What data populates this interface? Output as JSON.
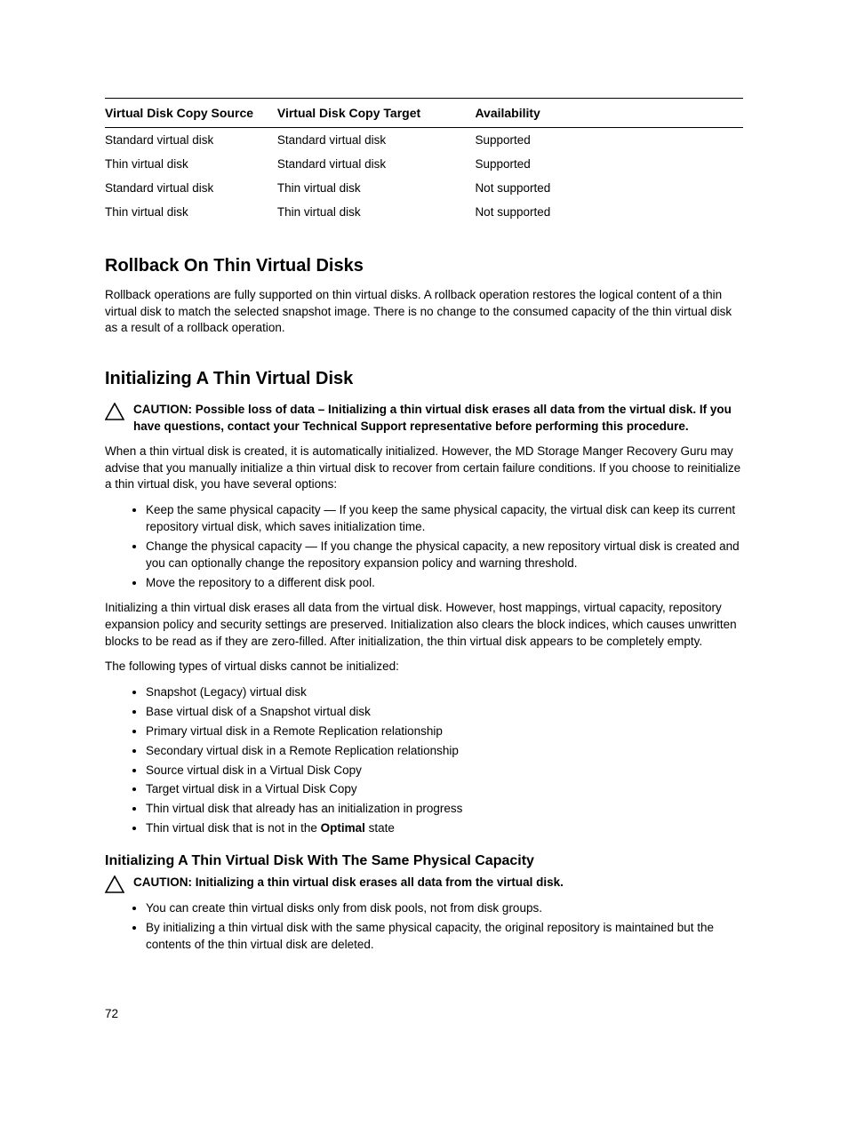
{
  "table": {
    "headers": [
      "Virtual Disk Copy Source",
      "Virtual Disk Copy Target",
      "Availability"
    ],
    "rows": [
      [
        "Standard virtual disk",
        "Standard virtual disk",
        "Supported"
      ],
      [
        "Thin virtual disk",
        "Standard virtual disk",
        "Supported"
      ],
      [
        "Standard virtual disk",
        "Thin virtual disk",
        "Not supported"
      ],
      [
        "Thin virtual disk",
        "Thin virtual disk",
        "Not supported"
      ]
    ]
  },
  "section1": {
    "title": "Rollback On Thin Virtual Disks",
    "p1": "Rollback operations are fully supported on thin virtual disks. A rollback operation restores the logical content of a thin virtual disk to match the selected snapshot image. There is no change to the consumed capacity of the thin virtual disk as a result of a rollback operation."
  },
  "section2": {
    "title": "Initializing A Thin Virtual Disk",
    "caution1": "CAUTION: Possible loss of data – Initializing a thin virtual disk erases all data from the virtual disk. If you have questions, contact your Technical Support representative before performing this procedure.",
    "p1": "When a thin virtual disk is created, it is automatically initialized. However, the MD Storage Manger Recovery Guru may advise that you manually initialize a thin virtual disk to recover from certain failure conditions. If you choose to reinitialize a thin virtual disk, you have several options:",
    "options": [
      "Keep the same physical capacity — If you keep the same physical capacity, the virtual disk can keep its current repository virtual disk, which saves initialization time.",
      "Change the physical capacity — If you change the physical capacity, a new repository virtual disk is created and you can optionally change the repository expansion policy and warning threshold.",
      "Move the repository to a different disk pool."
    ],
    "p2": "Initializing a thin virtual disk erases all data from the virtual disk. However, host mappings, virtual capacity, repository expansion policy and security settings are preserved. Initialization also clears the block indices, which causes unwritten blocks to be read as if they are zero-filled. After initialization, the thin virtual disk appears to be completely empty.",
    "p3": "The following types of virtual disks cannot be initialized:",
    "cannot_list": [
      "Snapshot (Legacy) virtual disk",
      "Base virtual disk of a Snapshot virtual disk",
      "Primary virtual disk in a Remote Replication relationship",
      "Secondary virtual disk in a Remote Replication relationship",
      "Source virtual disk in a Virtual Disk Copy",
      "Target virtual disk in a Virtual Disk Copy",
      "Thin virtual disk that already has an initialization in progress"
    ],
    "cannot_last_pre": "Thin virtual disk that is not in the ",
    "cannot_last_bold": "Optimal",
    "cannot_last_post": " state",
    "sub1_title": "Initializing A Thin Virtual Disk With The Same Physical Capacity",
    "caution2": "CAUTION: Initializing a thin virtual disk erases all data from the virtual disk.",
    "sub1_list": [
      "You can create thin virtual disks only from disk pools, not from disk groups.",
      "By initializing a thin virtual disk with the same physical capacity, the original repository is maintained but the contents of the thin virtual disk are deleted."
    ]
  },
  "page_number": "72"
}
